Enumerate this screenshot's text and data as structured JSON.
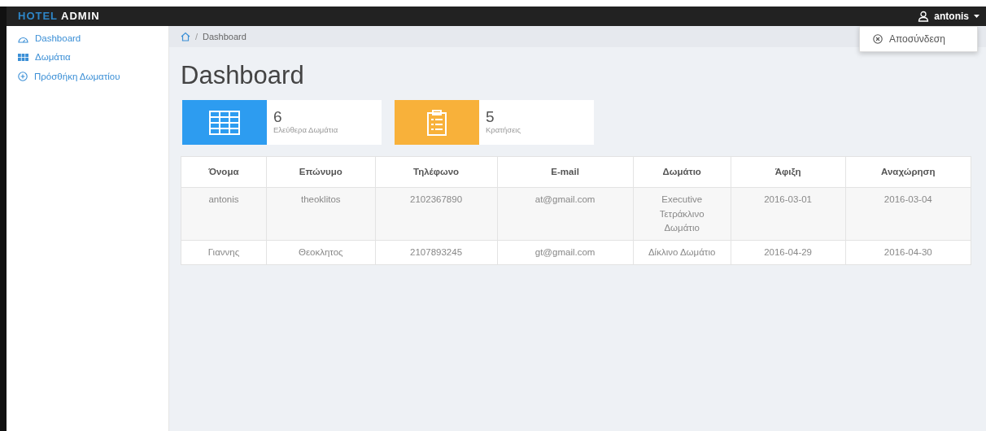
{
  "brand": {
    "accent": "HOTEL",
    "rest": "ADMIN"
  },
  "user_menu": {
    "username": "antonis",
    "expanded": true,
    "items": [
      "Αποσύνδεση"
    ]
  },
  "sidebar": {
    "items": [
      {
        "label": "Dashboard",
        "kind": "dashboard"
      },
      {
        "label": "Δωμάτια",
        "kind": "rooms"
      },
      {
        "label": "Πρόσθήκη Δωματίου",
        "kind": "add"
      }
    ]
  },
  "breadcrumb": [
    {
      "separator": "/",
      "label": "Dashboard"
    }
  ],
  "page_title": "Dashboard",
  "stats": [
    {
      "value": "6",
      "label": "Ελεύθερα Δωμάτια",
      "kind": "rooms",
      "color": "#2d9cf0"
    },
    {
      "value": "5",
      "label": "Κρατήσεις",
      "kind": "bookings",
      "color": "#f8b13a"
    }
  ],
  "table": {
    "columns": [
      "Όνομα",
      "Επώνυμο",
      "Τηλέφωνο",
      "E-mail",
      "Δωμάτιο",
      "Άφιξη",
      "Αναχώρηση"
    ],
    "rows": [
      [
        "antonis",
        "theoklitos",
        "2102367890",
        "at@gmail.com",
        "Executive Τετράκλινο Δωμάτιο",
        "2016-03-01",
        "2016-03-04"
      ],
      [
        "Γιαννης",
        "Θεοκλητος",
        "2107893245",
        "gt@gmail.com",
        "Δίκλινο Δωμάτιο",
        "2016-04-29",
        "2016-04-30"
      ]
    ]
  }
}
